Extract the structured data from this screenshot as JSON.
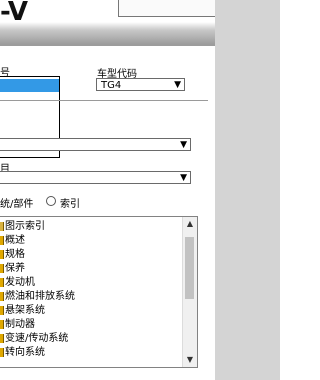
{
  "banner": {
    "title": "-V"
  },
  "fields": {
    "left_label_fragment": "号",
    "vehicle_code_label": "车型代码",
    "vehicle_code_value": "TG4",
    "project_label_fragment": "目"
  },
  "search_mode": {
    "system_label_fragment": "统/部件",
    "index_label": "索引"
  },
  "tree": {
    "items": [
      "图示索引",
      "概述",
      "规格",
      "保养",
      "发动机",
      "燃油和排放系统",
      "悬架系统",
      "制动器",
      "变速/传动系统",
      "转向系统"
    ]
  }
}
